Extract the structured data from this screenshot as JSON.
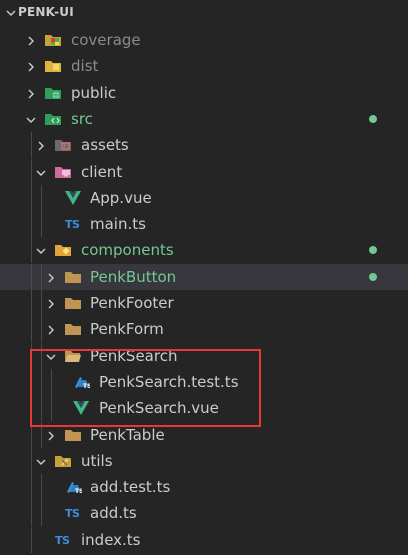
{
  "explorer": {
    "root_title": "PENK-UI",
    "items": [
      {
        "label": "coverage",
        "type": "folder",
        "icon": "folder-coverage-icon",
        "expanded": false,
        "level": 1,
        "color": "#8b8b8b"
      },
      {
        "label": "dist",
        "type": "folder",
        "icon": "folder-dist-icon",
        "expanded": false,
        "level": 1,
        "color": "#8b8b8b"
      },
      {
        "label": "public",
        "type": "folder",
        "icon": "folder-public-icon",
        "expanded": false,
        "level": 1,
        "color": "#cccccc"
      },
      {
        "label": "src",
        "type": "folder",
        "icon": "folder-src-icon",
        "expanded": true,
        "level": 1,
        "color": "#73c991",
        "modified": true
      },
      {
        "label": "assets",
        "type": "folder",
        "icon": "folder-assets-icon",
        "expanded": false,
        "level": 2,
        "color": "#cccccc"
      },
      {
        "label": "client",
        "type": "folder",
        "icon": "folder-client-icon",
        "expanded": true,
        "level": 2,
        "color": "#cccccc"
      },
      {
        "label": "App.vue",
        "type": "file",
        "icon": "vue-icon",
        "level": 3,
        "color": "#cccccc"
      },
      {
        "label": "main.ts",
        "type": "file",
        "icon": "ts-icon",
        "level": 3,
        "color": "#cccccc"
      },
      {
        "label": "components",
        "type": "folder",
        "icon": "folder-components-icon",
        "expanded": true,
        "level": 2,
        "color": "#73c991",
        "modified": true
      },
      {
        "label": "PenkButton",
        "type": "folder",
        "icon": "folder-icon",
        "expanded": false,
        "level": 3,
        "color": "#73c991",
        "modified": true,
        "selected": true
      },
      {
        "label": "PenkFooter",
        "type": "folder",
        "icon": "folder-icon",
        "expanded": false,
        "level": 3,
        "color": "#cccccc"
      },
      {
        "label": "PenkForm",
        "type": "folder",
        "icon": "folder-icon",
        "expanded": false,
        "level": 3,
        "color": "#cccccc"
      },
      {
        "label": "PenkSearch",
        "type": "folder",
        "icon": "folder-open-icon",
        "expanded": true,
        "level": 3,
        "color": "#cccccc"
      },
      {
        "label": "PenkSearch.test.ts",
        "type": "file",
        "icon": "test-ts-icon",
        "level": 4,
        "color": "#cccccc"
      },
      {
        "label": "PenkSearch.vue",
        "type": "file",
        "icon": "vue-icon",
        "level": 4,
        "color": "#cccccc"
      },
      {
        "label": "PenkTable",
        "type": "folder",
        "icon": "folder-icon",
        "expanded": false,
        "level": 3,
        "color": "#cccccc"
      },
      {
        "label": "utils",
        "type": "folder",
        "icon": "folder-utils-icon",
        "expanded": true,
        "level": 2,
        "color": "#cccccc"
      },
      {
        "label": "add.test.ts",
        "type": "file",
        "icon": "test-ts-icon",
        "level": 3,
        "color": "#cccccc"
      },
      {
        "label": "add.ts",
        "type": "file",
        "icon": "ts-icon",
        "level": 3,
        "color": "#cccccc"
      },
      {
        "label": "index.ts",
        "type": "file",
        "icon": "ts-icon",
        "level": 2,
        "color": "#cccccc"
      }
    ],
    "ts_glyph": "TS",
    "colors": {
      "background": "#252526",
      "selected_row": "#37373d",
      "modified": "#73c991",
      "dimmed": "#8b8b8b",
      "highlight_box": "#e53935"
    }
  }
}
